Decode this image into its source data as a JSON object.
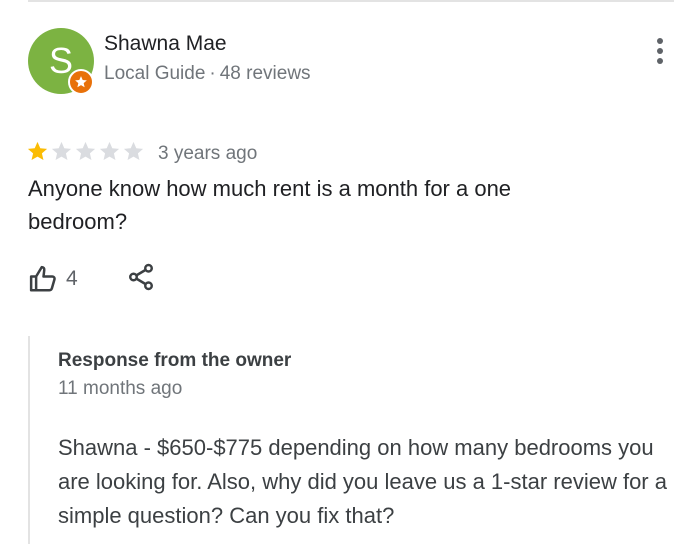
{
  "review": {
    "author": {
      "initial": "S",
      "name": "Shawna Mae",
      "badge": "Local Guide",
      "separator": "·",
      "review_count": "48 reviews",
      "avatar_color": "#7cb342",
      "badge_color": "#e8710a",
      "badge_icon": "star-icon"
    },
    "rating": 1,
    "max_rating": 5,
    "time": "3 years ago",
    "text": "Anyone know how much rent is a month for a one bedroom?",
    "likes": "4",
    "star_color_filled": "#fbbc04",
    "star_color_empty": "#dadce0"
  },
  "owner_response": {
    "title": "Response from the owner",
    "time": "11 months ago",
    "text": "Shawna - $650-$775 depending on how many bedrooms you are looking for. Also, why did you leave us a 1-star review for a simple question? Can you fix that?"
  }
}
